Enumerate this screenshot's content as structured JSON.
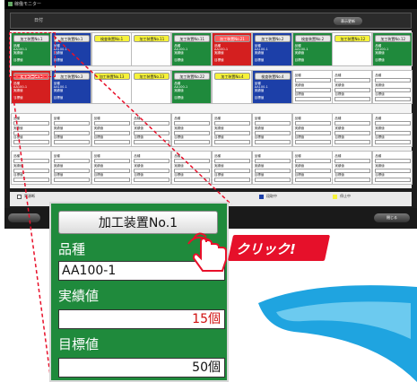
{
  "window": {
    "title": "稼働モニター"
  },
  "toolbar": {
    "label": "日付",
    "button": "表示更新"
  },
  "machines_row1": [
    {
      "name": "加工装置No.1",
      "state": "green"
    },
    {
      "name": "加工装置No.1",
      "state": "blue"
    },
    {
      "name": "検査装置No.1",
      "state": "yellow"
    },
    {
      "name": "加工装置No.11",
      "state": "yellow"
    },
    {
      "name": "加工装置No.11",
      "state": "green"
    },
    {
      "name": "加工装置No.21",
      "state": "red"
    },
    {
      "name": "加工装置No.2",
      "state": "blue"
    },
    {
      "name": "検査装置No.2",
      "state": "green"
    },
    {
      "name": "加工装置No.12",
      "state": "yellow"
    },
    {
      "name": "加工装置No.12",
      "state": "green"
    }
  ],
  "machines_row2": [
    {
      "name": "加工装置No.1",
      "state": "red"
    },
    {
      "name": "加工装置No.3",
      "state": "blue"
    },
    {
      "name": "加工装置No.13",
      "state": "yellow"
    },
    {
      "name": "加工装置No.13",
      "state": "yellow"
    },
    {
      "name": "加工装置No.22",
      "state": "green"
    },
    {
      "name": "加工装置No.4",
      "state": "yellow"
    },
    {
      "name": "検査装置No.4",
      "state": "blue"
    }
  ],
  "cell_labels": {
    "product": "品種",
    "actual": "実績値",
    "target": "目標値",
    "part": "AA100-1"
  },
  "legend": {
    "stop": "電源断",
    "running": "稼動中",
    "idle": "段取中",
    "halt": "停止中"
  },
  "bottom": {
    "left_button": "",
    "right_button": "閉じる"
  },
  "zoom": {
    "button": "加工装置No.1",
    "product_label": "品種",
    "product_value": "AA100-1",
    "actual_label": "実績値",
    "actual_value": "15個",
    "target_label": "目標値",
    "target_value": "50個"
  },
  "callout": {
    "text": "クリック!"
  },
  "colors": {
    "running": "#1f8a3c",
    "setup": "#1c3fa8",
    "alarm": "#d41f1f",
    "waiting": "#f6f23a",
    "highlight": "#e8102a",
    "swoosh": "#1fa4e0"
  }
}
